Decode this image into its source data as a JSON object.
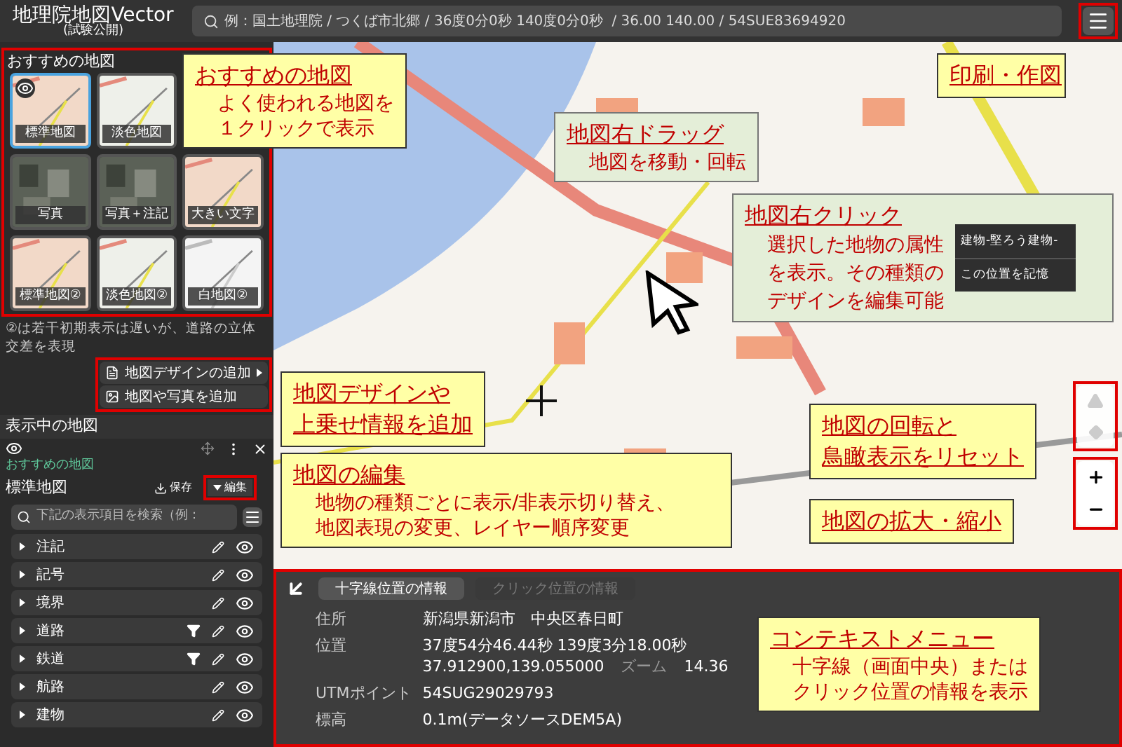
{
  "header": {
    "title": "地理院地図Vector",
    "subtitle": "(試験公開)",
    "search_placeholder": "例：国土地理院 / つくば市北郷 / 36度0分0秒 140度0分0秒  / 36.00 140.00 / 54SUE83694920"
  },
  "recommended": {
    "heading": "おすすめの地図",
    "tile_rows": [
      [
        {
          "label": "標準地図",
          "kind": "map",
          "selected": true
        },
        {
          "label": "淡色地図",
          "kind": "pale",
          "selected": false
        }
      ],
      [
        {
          "label": "写真",
          "kind": "photo",
          "selected": false
        },
        {
          "label": "写真＋注記",
          "kind": "photo",
          "selected": false
        },
        {
          "label": "大きい文字",
          "kind": "map",
          "selected": false
        }
      ],
      [
        {
          "label": "標準地図②",
          "kind": "map",
          "selected": false
        },
        {
          "label": "淡色地図②",
          "kind": "pale",
          "selected": false
        },
        {
          "label": "白地図②",
          "kind": "white",
          "selected": false
        }
      ]
    ],
    "note": "②は若干初期表示は遅いが、道路の立体交差を表現"
  },
  "add_buttons": [
    {
      "label": "地図デザインの追加",
      "kind": "design"
    },
    {
      "label": "地図や写真を追加",
      "kind": "photo"
    }
  ],
  "current": {
    "heading": "表示中の地図",
    "category": "おすすめの地図",
    "map_name": "標準地図",
    "save": "保存",
    "edit": "編集",
    "search_placeholder": "下記の表示項目を検索（例：",
    "layers": [
      {
        "name": "注記",
        "filter": false
      },
      {
        "name": "記号",
        "filter": false
      },
      {
        "name": "境界",
        "filter": false
      },
      {
        "name": "道路",
        "filter": true
      },
      {
        "name": "鉄道",
        "filter": true
      },
      {
        "name": "航路",
        "filter": false
      },
      {
        "name": "建物",
        "filter": false
      }
    ]
  },
  "info_panel": {
    "tabs": [
      {
        "label": "十字線位置の情報",
        "selected": true
      },
      {
        "label": "クリック位置の情報",
        "selected": false
      }
    ],
    "address": {
      "label": "住所",
      "value": "新潟県新潟市　中央区春日町"
    },
    "position": {
      "label": "位置",
      "dms": "37度54分46.44秒 139度3分18.00秒",
      "decimal": "37.912900,139.055000",
      "zoom_label": "ズーム",
      "zoom": "14.36"
    },
    "utm": {
      "label": "UTMポイント",
      "value": "54SUG29029793"
    },
    "elevation": {
      "label": "標高",
      "value": "0.1m(データソースDEM5A)"
    }
  },
  "context_menu": [
    "建物-堅ろう建物-",
    "この位置を記憶"
  ],
  "callouts": [
    {
      "kind": "yellow",
      "title_lines": [
        "おすすめの地図"
      ],
      "body_lines": [
        "よく使われる地図を",
        "１クリックで表示"
      ]
    },
    {
      "kind": "yellow",
      "title_lines": [
        "印刷・作図"
      ]
    },
    {
      "kind": "green",
      "title_lines": [
        "地図右ドラッグ"
      ],
      "body_lines": [
        "地図を移動・回転"
      ]
    },
    {
      "kind": "green",
      "title_lines": [
        "地図右クリック"
      ],
      "body_lines": [
        "選択した地物の属性",
        "を表示。その種類の",
        "デザインを編集可能"
      ]
    },
    {
      "kind": "yellow",
      "title_lines": [
        "地図デザインや",
        "上乗せ情報を追加"
      ]
    },
    {
      "kind": "yellow",
      "title_lines": [
        "地図の編集"
      ],
      "body_lines": [
        "地物の種類ごとに表示/非表示切り替え、",
        "地図表現の変更、レイヤー順序変更"
      ]
    },
    {
      "kind": "yellow",
      "title_lines": [
        "地図の回転と",
        "鳥瞰表示をリセット"
      ]
    },
    {
      "kind": "yellow",
      "title_lines": [
        "地図の拡大・縮小"
      ]
    },
    {
      "kind": "yellow",
      "title_lines": [
        "コンテキストメニュー"
      ],
      "body_lines": [
        "十字線（画面中央）または",
        "クリック位置の情報を表示"
      ]
    }
  ]
}
